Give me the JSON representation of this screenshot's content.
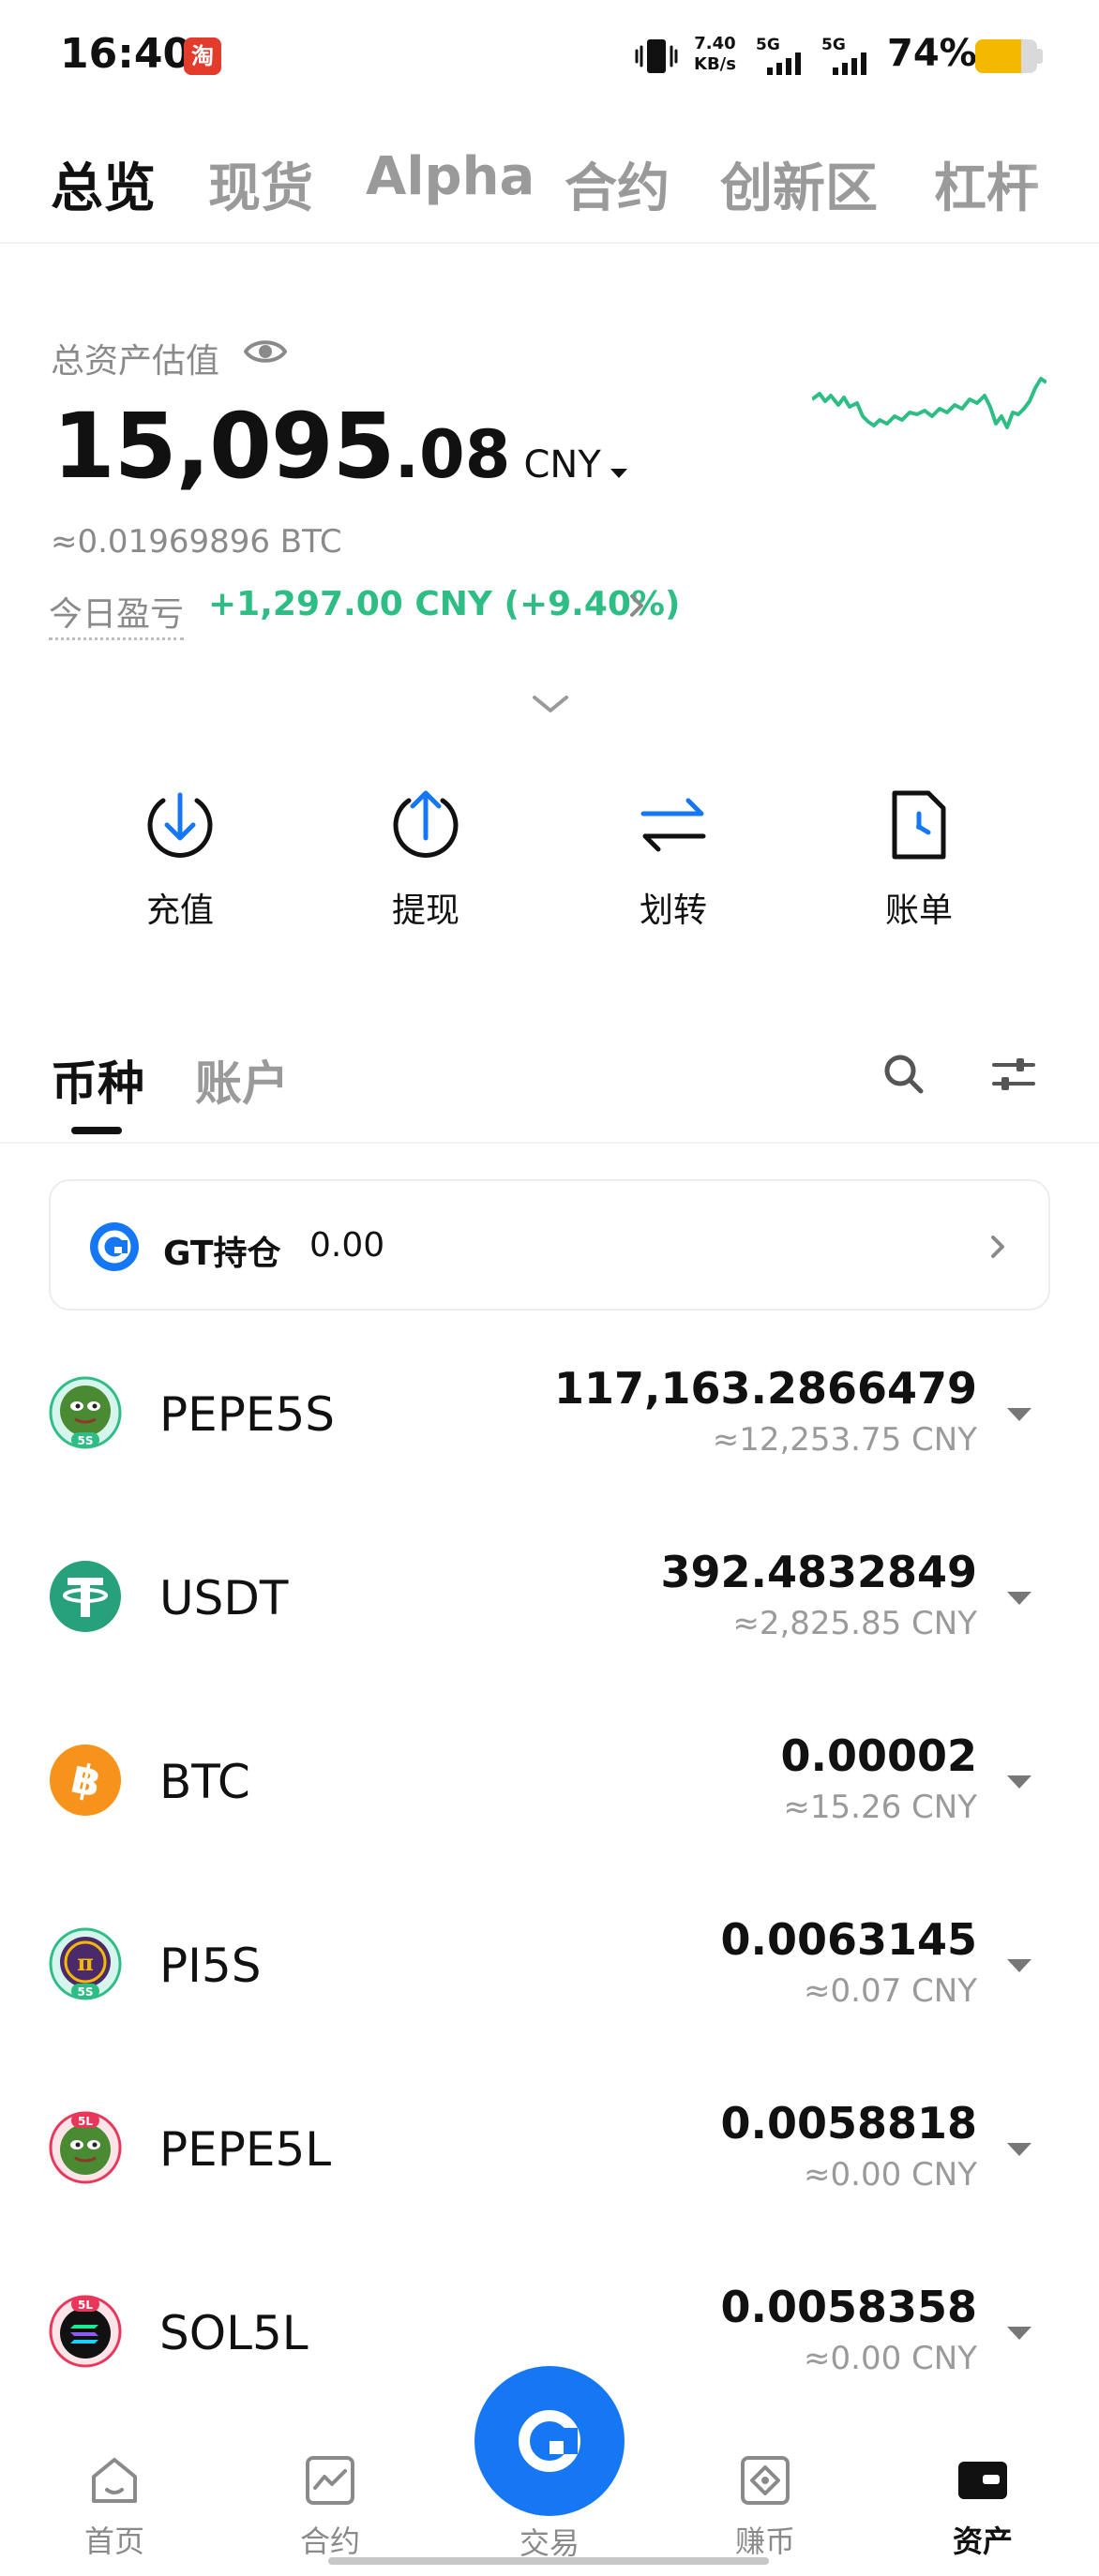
{
  "status_bar": {
    "time": "16:40",
    "app_badge": "淘",
    "net_speed_value": "7.40",
    "net_speed_unit": "KB/s",
    "signal_1_gen": "5G",
    "signal_2_gen": "5G",
    "battery_percent": "74%",
    "battery_level": 0.74
  },
  "top_tabs": [
    {
      "label": "总览",
      "active": true
    },
    {
      "label": "现货",
      "active": false
    },
    {
      "label": "Alpha",
      "active": false
    },
    {
      "label": "合约",
      "active": false
    },
    {
      "label": "创新区",
      "active": false
    },
    {
      "label": "杠杆",
      "active": false
    }
  ],
  "overview": {
    "total_label": "总资产估值",
    "balance_int": "15,095",
    "balance_dec": ".08",
    "currency": "CNY",
    "btc_equiv": "≈0.01969896 BTC",
    "pnl_label": "今日盈亏",
    "pnl_value": "+1,297.00 CNY (+9.40%)",
    "sparkline_color": "#2ebd85"
  },
  "actions": [
    {
      "label": "充值",
      "icon": "deposit-icon"
    },
    {
      "label": "提现",
      "icon": "withdraw-icon"
    },
    {
      "label": "划转",
      "icon": "transfer-icon"
    },
    {
      "label": "账单",
      "icon": "bill-icon"
    }
  ],
  "asset_tabs": [
    {
      "label": "币种",
      "active": true
    },
    {
      "label": "账户",
      "active": false
    }
  ],
  "gt": {
    "label": "GT持仓",
    "value": "0.00"
  },
  "coins": [
    {
      "symbol": "PEPE5S",
      "amount": "117,163.2866479",
      "value": "≈12,253.75 CNY",
      "icon": "pepe-icon",
      "badge": "5S"
    },
    {
      "symbol": "USDT",
      "amount": "392.4832849",
      "value": "≈2,825.85 CNY",
      "icon": "tether-icon",
      "badge": ""
    },
    {
      "symbol": "BTC",
      "amount": "0.00002",
      "value": "≈15.26 CNY",
      "icon": "bitcoin-icon",
      "badge": ""
    },
    {
      "symbol": "PI5S",
      "amount": "0.0063145",
      "value": "≈0.07 CNY",
      "icon": "pi-icon",
      "badge": "5S"
    },
    {
      "symbol": "PEPE5L",
      "amount": "0.0058818",
      "value": "≈0.00 CNY",
      "icon": "pepe-icon",
      "badge": "5L"
    },
    {
      "symbol": "SOL5L",
      "amount": "0.0058358",
      "value": "≈0.00 CNY",
      "icon": "solana-icon",
      "badge": "5L"
    }
  ],
  "bottom_nav": [
    {
      "label": "首页",
      "icon": "home-icon",
      "active": false
    },
    {
      "label": "合约",
      "icon": "futures-icon",
      "active": false
    },
    {
      "label": "交易",
      "icon": "trade-icon",
      "active": false
    },
    {
      "label": "赚币",
      "icon": "earn-icon",
      "active": false
    },
    {
      "label": "资产",
      "icon": "wallet-icon",
      "active": true
    }
  ],
  "colors": {
    "brand_blue": "#1677f5",
    "gain_green": "#2ebd85",
    "battery_yellow": "#f5b800"
  }
}
